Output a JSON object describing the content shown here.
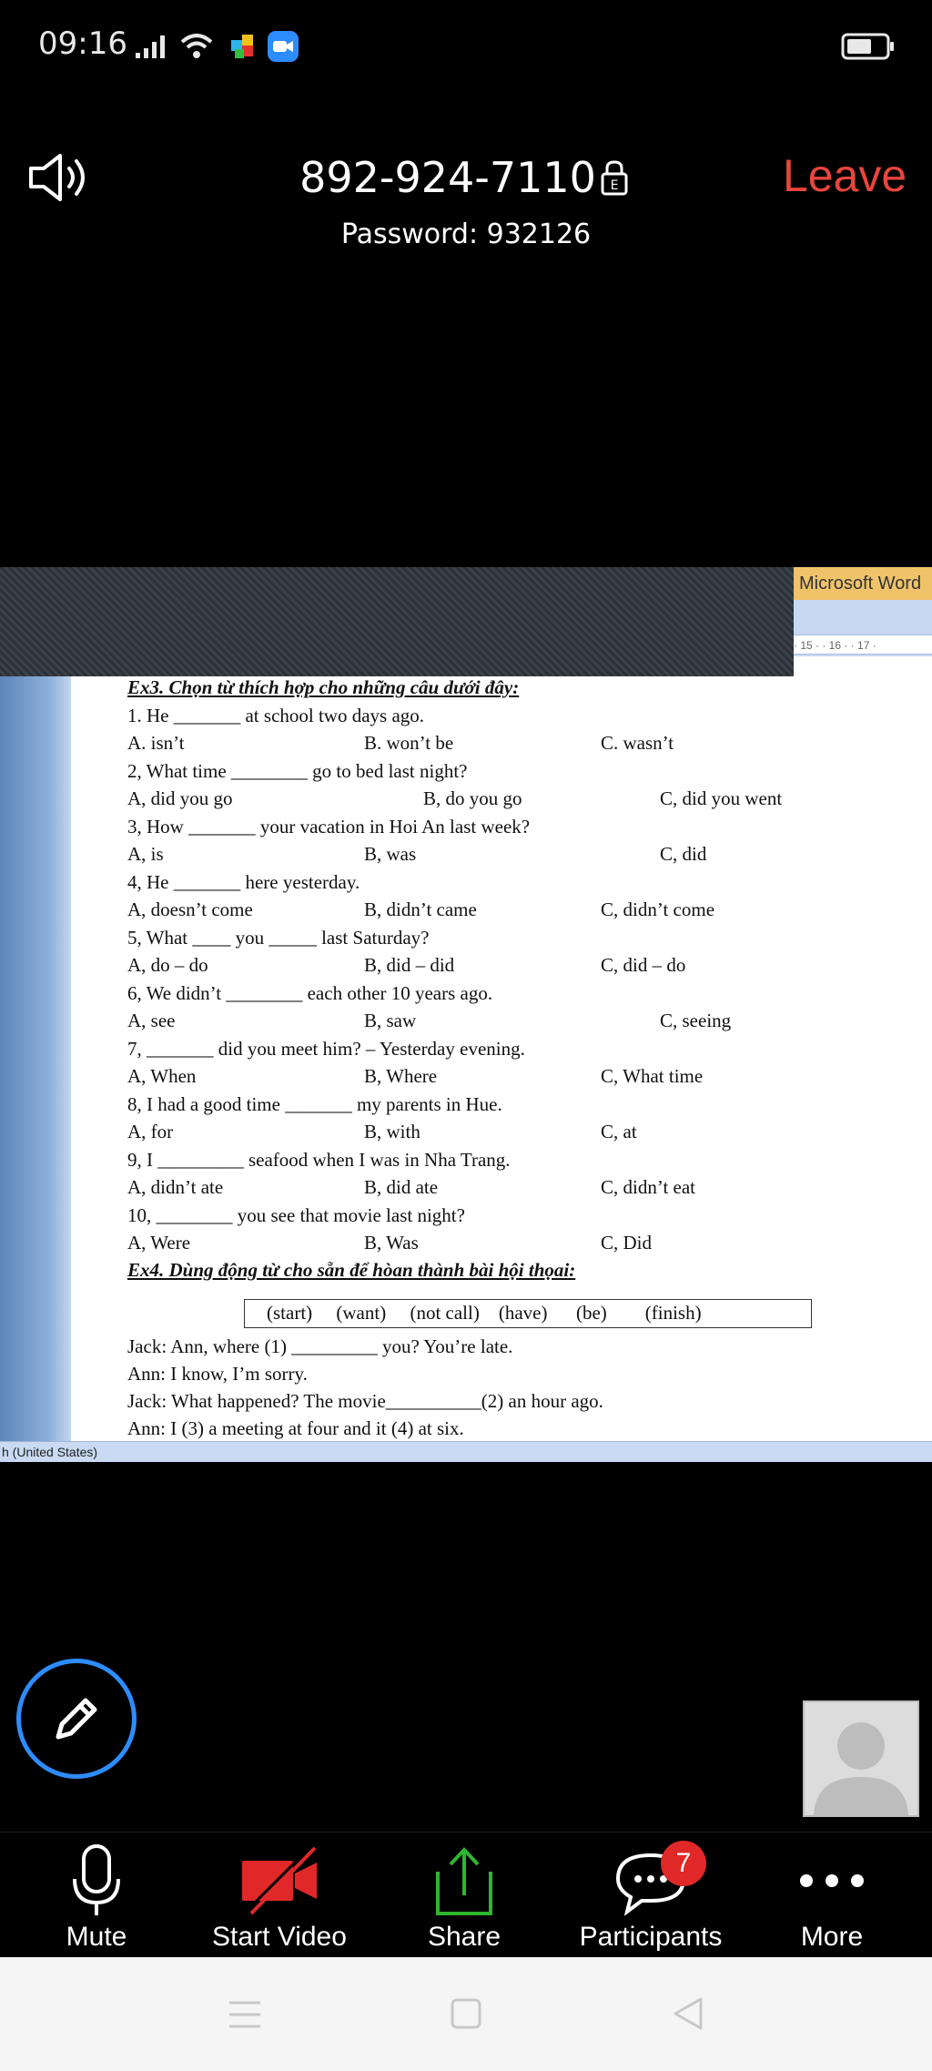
{
  "status_bar": {
    "time": "09:16",
    "icons": [
      "signal-icon",
      "wifi-icon",
      "app-notification-icon",
      "zoom-notification-icon",
      "battery-icon"
    ]
  },
  "meeting": {
    "meeting_id": "892-924-7110",
    "password_label": "Password: 932126",
    "leave_label": "Leave",
    "leave_color": "#e8453c"
  },
  "shared_screen": {
    "app_title": "Microsoft Word",
    "ruler_text": "· 15 · · 16 · · 17 ·",
    "statusbar_text": "h (United States)",
    "exercise3": {
      "heading": "Ex3. Chọn từ thích hợp cho những câu dưới đây:",
      "questions": [
        {
          "q": "1. He _______ at school two days ago.",
          "a": "A. isn’t",
          "b": "B. won’t be",
          "c": "C. wasn’t"
        },
        {
          "q": "2, What time ________ go to bed last night?",
          "a": "A, did you go",
          "b": "B, do you go",
          "c": "C, did you went"
        },
        {
          "q": "3, How _______ your vacation in Hoi An last week?",
          "a": "A, is",
          "b": "B, was",
          "c": "C, did"
        },
        {
          "q": "4, He _______ here yesterday.",
          "a": "A, doesn’t come",
          "b": "B, didn’t came",
          "c": "C, didn’t come"
        },
        {
          "q": "5, What ____ you _____ last Saturday?",
          "a": "A, do – do",
          "b": "B, did – did",
          "c": "C, did – do"
        },
        {
          "q": "6, We didn’t ________ each other 10 years ago.",
          "a": "A, see",
          "b": "B, saw",
          "c": "C, seeing"
        },
        {
          "q": "7, _______ did you meet him? – Yesterday evening.",
          "a": "A, When",
          "b": "B, Where",
          "c": "C, What time"
        },
        {
          "q": "8, I had a good time _______ my parents in Hue.",
          "a": "A, for",
          "b": "B, with",
          "c": "C, at"
        },
        {
          "q": "9, I _________ seafood when I was in Nha Trang.",
          "a": "A, didn’t ate",
          "b": "B, did ate",
          "c": "C, didn’t eat"
        },
        {
          "q": "10, ________ you see that movie last night?",
          "a": "A, Were",
          "b": "B, Was",
          "c": "C, Did"
        }
      ]
    },
    "exercise4": {
      "heading": "Ex4. Dùng động từ cho sẵn để hòan thành bài hội thọai:",
      "word_box": "(start)     (want)     (not call)    (have)      (be)        (finish)",
      "dialogue": [
        "Jack: Ann, where (1) _________ you? You’re late.",
        "Ann: I know,  I’m sorry.",
        "Jack: What happened? The movie__________(2) an hour ago.",
        "Ann: I (3)              a meeting at four and it (4)                  at six."
      ]
    }
  },
  "toolbar": {
    "mute_label": "Mute",
    "start_video_label": "Start Video",
    "share_label": "Share",
    "participants_label": "Participants",
    "participants_badge": "7",
    "more_label": "More",
    "video_off_color": "#e02828",
    "share_color": "#2fb52f"
  }
}
